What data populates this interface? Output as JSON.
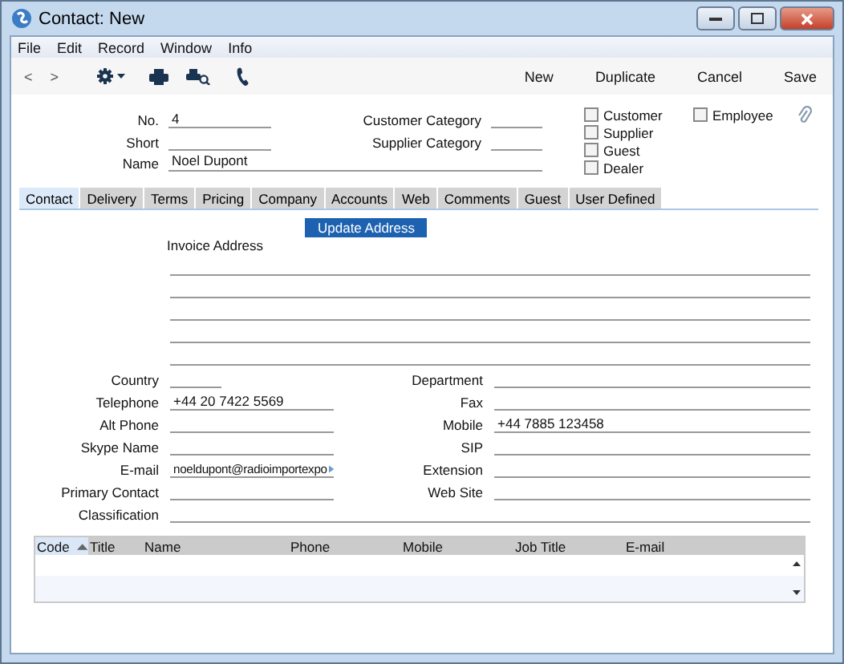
{
  "window": {
    "title": "Contact: New"
  },
  "menu": [
    "File",
    "Edit",
    "Record",
    "Window",
    "Info"
  ],
  "toolbar": {
    "nav": [
      "<",
      ">"
    ],
    "buttons": [
      "New",
      "Duplicate",
      "Cancel",
      "Save"
    ]
  },
  "header": {
    "fields": [
      {
        "label": "No.",
        "value": "4"
      },
      {
        "label": "Short"
      },
      {
        "label": "Name",
        "value": "Noel Dupont",
        "kind": "wide"
      }
    ],
    "categories": [
      {
        "label": "Customer Category"
      },
      {
        "label": "Supplier Category"
      }
    ],
    "flags": [
      {
        "label": "Customer",
        "checked": false
      },
      {
        "label": "Supplier",
        "checked": false
      },
      {
        "label": "Guest",
        "checked": false
      },
      {
        "label": "Dealer",
        "checked": false
      }
    ],
    "employee": {
      "label": "Employee",
      "checked": false
    }
  },
  "tabs": [
    {
      "label": "Contact",
      "selected": true
    },
    {
      "label": "Delivery",
      "selected": false
    },
    {
      "label": "Terms",
      "selected": false
    },
    {
      "label": "Pricing",
      "selected": false
    },
    {
      "label": "Company",
      "selected": false
    },
    {
      "label": "Accounts",
      "selected": false
    },
    {
      "label": "Web",
      "selected": false
    },
    {
      "label": "Comments",
      "selected": false
    },
    {
      "label": "Guest",
      "selected": false
    },
    {
      "label": "User Defined",
      "selected": false
    }
  ],
  "update_button": "Update Address",
  "invoice_address": {
    "label": "Invoice Address"
  },
  "fields": [
    {
      "left": {
        "label": "Country",
        "kind": "short"
      },
      "right": {
        "label": "Department"
      }
    },
    {
      "left": {
        "label": "Telephone",
        "value": "+44 20 7422 5569"
      },
      "right": {
        "label": "Fax"
      }
    },
    {
      "left": {
        "label": "Alt Phone"
      },
      "right": {
        "label": "Mobile",
        "value": "+44 7885 123458"
      }
    },
    {
      "left": {
        "label": "Skype Name"
      },
      "right": {
        "label": "SIP"
      }
    },
    {
      "left": {
        "label": "E-mail",
        "value": "noeldupont@radioimportexpo",
        "kind": "overflow"
      },
      "right": {
        "label": "Extension"
      }
    },
    {
      "left": {
        "label": "Primary Contact"
      },
      "right": {
        "label": "Web Site"
      }
    }
  ],
  "classification": {
    "label": "Classification"
  },
  "table": {
    "columns": [
      {
        "label": "Code",
        "selected": true
      },
      {
        "label": "Title",
        "selected": false
      },
      {
        "label": "Name",
        "selected": false
      },
      {
        "label": "Phone",
        "selected": false
      },
      {
        "label": "Mobile",
        "selected": false
      },
      {
        "label": "Job Title",
        "selected": false
      },
      {
        "label": "E-mail",
        "selected": false
      }
    ]
  }
}
